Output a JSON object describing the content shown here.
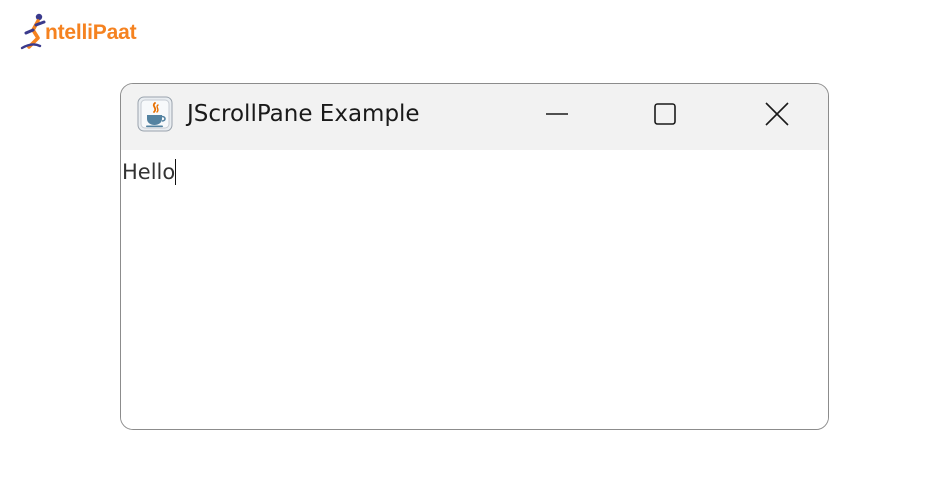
{
  "brand": {
    "logo_text": "ntelliPaat",
    "logo_initial": "I",
    "color": "#f58220",
    "accent": "#3a3a8c"
  },
  "window": {
    "title": "JScrollPane Example",
    "icon": "java-icon",
    "controls": {
      "minimize": "minimize-icon",
      "maximize": "maximize-icon",
      "close": "close-icon"
    }
  },
  "content": {
    "text": "Hello"
  }
}
